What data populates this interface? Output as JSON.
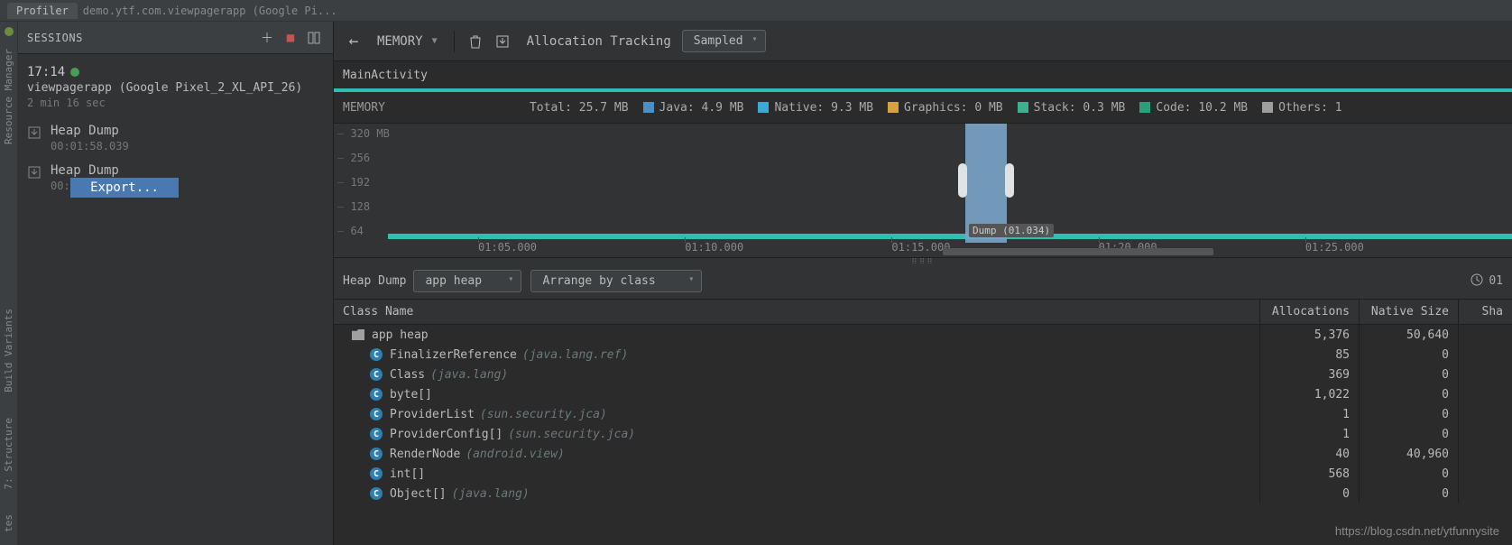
{
  "top": {
    "profiler_tab": "Profiler",
    "process_title": "demo.ytf.com.viewpagerapp (Google Pi..."
  },
  "left_rail": {
    "resource_manager": "Resource Manager",
    "build_variants": "Build Variants",
    "structure": "7: Structure",
    "tes": "tes"
  },
  "sessions": {
    "title": "SESSIONS",
    "entry": {
      "time": "17:14",
      "desc": "viewpagerapp (Google Pixel_2_XL_API_26)",
      "elapsed": "2 min 16 sec"
    },
    "dumps": [
      {
        "label": "Heap Dump",
        "ts": "00:01:58.039"
      },
      {
        "label": "Heap Dump",
        "ts": "00:01"
      }
    ],
    "context_menu": {
      "export": "Export..."
    }
  },
  "toolbar": {
    "view": "MEMORY",
    "alloc_tracking_label": "Allocation Tracking",
    "alloc_mode": "Sampled"
  },
  "activity": {
    "name": "MainActivity"
  },
  "memory_legend": {
    "title": "MEMORY",
    "total": "Total: 25.7 MB",
    "java": {
      "label": "Java: 4.9 MB",
      "color": "#4a8fc7"
    },
    "native": {
      "label": "Native: 9.3 MB",
      "color": "#3fa7d6"
    },
    "graphics": {
      "label": "Graphics: 0 MB",
      "color": "#d6a23f"
    },
    "stack": {
      "label": "Stack: 0.3 MB",
      "color": "#3fb08f"
    },
    "code": {
      "label": "Code: 10.2 MB",
      "color": "#2e9e7a"
    },
    "others": {
      "label": "Others: 1",
      "color": "#9e9e9e"
    }
  },
  "chart": {
    "y_ticks": [
      "320 MB",
      "256",
      "192",
      "128",
      "64"
    ],
    "x_ticks": [
      "01:05.000",
      "01:10.000",
      "01:15.000",
      "01:20.000",
      "01:25.000"
    ],
    "dump_marker": "Dump (01.034)"
  },
  "heap_filter": {
    "label": "Heap Dump",
    "heap_select": "app heap",
    "arrange_select": "Arrange by class",
    "duration_short": "01"
  },
  "table": {
    "headers": {
      "name": "Class Name",
      "alloc": "Allocations",
      "native": "Native Size",
      "shallow": "Sha"
    },
    "root": {
      "name": "app heap",
      "alloc": "5,376",
      "native": "50,640"
    },
    "rows": [
      {
        "cls": "FinalizerReference",
        "pkg": "(java.lang.ref)",
        "alloc": "85",
        "native": "0"
      },
      {
        "cls": "Class",
        "pkg": "(java.lang)",
        "alloc": "369",
        "native": "0"
      },
      {
        "cls": "byte[]",
        "pkg": "",
        "alloc": "1,022",
        "native": "0"
      },
      {
        "cls": "ProviderList",
        "pkg": "(sun.security.jca)",
        "alloc": "1",
        "native": "0"
      },
      {
        "cls": "ProviderConfig[]",
        "pkg": "(sun.security.jca)",
        "alloc": "1",
        "native": "0"
      },
      {
        "cls": "RenderNode",
        "pkg": "(android.view)",
        "alloc": "40",
        "native": "40,960"
      },
      {
        "cls": "int[]",
        "pkg": "",
        "alloc": "568",
        "native": "0"
      },
      {
        "cls": "Object[]",
        "pkg": "(java.lang)",
        "alloc": "0",
        "native": "0"
      }
    ]
  },
  "watermark": "https://blog.csdn.net/ytfunnysite"
}
